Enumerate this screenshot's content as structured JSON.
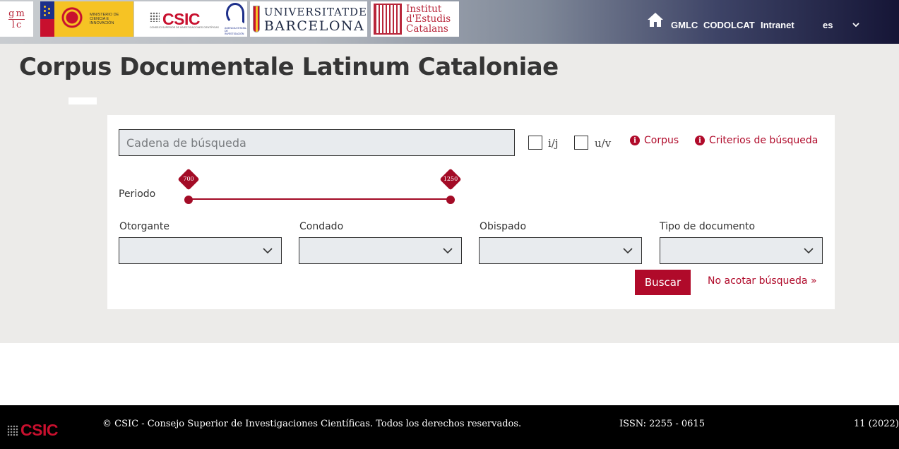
{
  "header": {
    "logos": {
      "gmlc": {
        "top": [
          "g",
          "m"
        ],
        "bottom": [
          "l",
          "c"
        ]
      },
      "ministerio": {
        "text": "MINISTERIO DE CIENCIA E INNOVACIÓN"
      },
      "csic": {
        "text": "CSIC",
        "sub": "CONSEJO SUPERIOR DE INVESTIGACIONES CIENTÍFICAS"
      },
      "aei": {
        "text": "AGENCIA ESTATAL DE INVESTIGACIÓN"
      },
      "ub": {
        "line1": "UNIVERSITATDE",
        "line2": "BARCELONA"
      },
      "iec": {
        "line1": "Institut",
        "line2": "d'Estudis",
        "line3": "Catalans"
      }
    },
    "nav": [
      "GMLC",
      "CODOLCAT",
      "Intranet"
    ],
    "language": "es"
  },
  "main": {
    "title": "Corpus Documentale Latinum Cataloniae",
    "search": {
      "placeholder": "Cadena de búsqueda",
      "check_ij": "i/j",
      "check_uv": "u/v",
      "link_corpus": "Corpus",
      "link_criteria": "Criterios de búsqueda",
      "info_glyph": "i"
    },
    "period": {
      "label": "Periodo",
      "min": 700,
      "max": 1250,
      "range_min": 700,
      "range_max": 1250,
      "from": "700",
      "to": "1250"
    },
    "filters": [
      {
        "label": "Otorgante",
        "value": ""
      },
      {
        "label": "Condado",
        "value": ""
      },
      {
        "label": "Obispado",
        "value": ""
      },
      {
        "label": "Tipo de documento",
        "value": ""
      }
    ],
    "buttons": {
      "search": "Buscar",
      "no_restrict": "No acotar búsqueda »"
    }
  },
  "footer": {
    "logo": "CSIC",
    "copyright": "© CSIC - Consejo Superior de Investigaciones Científicas. Todos los derechos reservados.",
    "issn": "ISSN: 2255 - 0615",
    "issue": "11 (2022)"
  },
  "colors": {
    "accent": "#b00a2a",
    "header_dark": "#151536",
    "panel_bg": "#ecebe9"
  }
}
